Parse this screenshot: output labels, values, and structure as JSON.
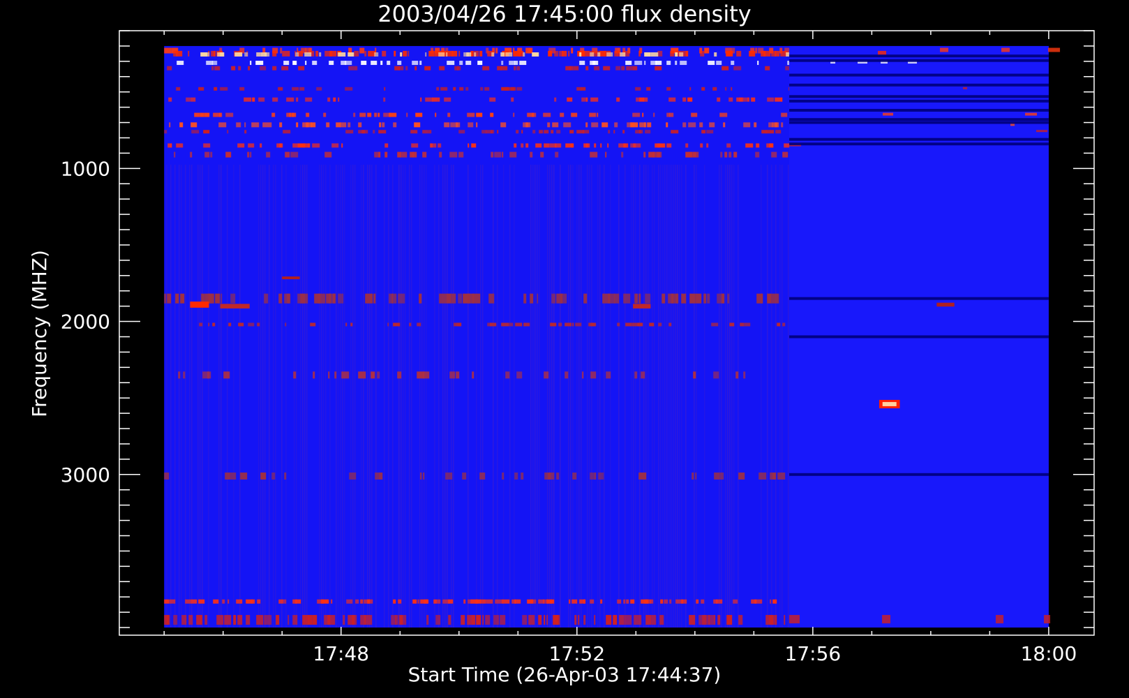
{
  "chart_data": {
    "type": "heatmap",
    "title": "2003/04/26 17:45:00 flux density",
    "xlabel": "Start Time (26-Apr-03 17:44:37)",
    "ylabel": "Frequency (MHZ)",
    "x_ticks": [
      "17:48",
      "17:52",
      "17:56",
      "18:00"
    ],
    "x_tick_minutes": [
      48,
      52,
      56,
      60
    ],
    "x_data_range_minutes": [
      45,
      60
    ],
    "x_axis_range_minutes": [
      44.24,
      60.77
    ],
    "y_ticks": [
      1000,
      2000,
      3000
    ],
    "y_axis_range_mhz": [
      100,
      4050
    ],
    "y_data_range_mhz": [
      200,
      4000
    ],
    "y_reversed": true,
    "colormap": [
      "#00008c",
      "#1e1eff",
      "#ff1e1e",
      "#ffffff"
    ],
    "background_color": "#1414f5",
    "grid": false,
    "bands": [
      {
        "f": 230,
        "h": 8,
        "color": "#ff3a10",
        "density": 0.35
      },
      {
        "f": 250,
        "h": 8,
        "color": "#ff2a00",
        "density": 0.55
      },
      {
        "f": 255,
        "h": 6,
        "color": "#ffd9a0",
        "density": 0.25
      },
      {
        "f": 310,
        "h": 6,
        "color": "#ffffff",
        "density": 0.35
      },
      {
        "f": 345,
        "h": 6,
        "color": "#d02020",
        "density": 0.25
      },
      {
        "f": 480,
        "h": 5,
        "color": "#c82020",
        "density": 0.3
      },
      {
        "f": 550,
        "h": 6,
        "color": "#ff3010",
        "density": 0.3
      },
      {
        "f": 650,
        "h": 6,
        "color": "#ff4010",
        "density": 0.35
      },
      {
        "f": 715,
        "h": 7,
        "color": "#ff5020",
        "density": 0.45
      },
      {
        "f": 760,
        "h": 5,
        "color": "#d02020",
        "density": 0.3
      },
      {
        "f": 850,
        "h": 6,
        "color": "#ff3010",
        "density": 0.4
      },
      {
        "f": 910,
        "h": 8,
        "color": "#c83030",
        "density": 0.35
      },
      {
        "f": 1850,
        "h": 14,
        "color": "#a03040",
        "density": 0.5
      },
      {
        "f": 2020,
        "h": 5,
        "color": "#c02828",
        "density": 0.3
      },
      {
        "f": 2350,
        "h": 10,
        "color": "#b03040",
        "density": 0.25
      },
      {
        "f": 3010,
        "h": 10,
        "color": "#a03040",
        "density": 0.2
      },
      {
        "f": 3830,
        "h": 6,
        "color": "#ff3010",
        "density": 0.45
      },
      {
        "f": 3950,
        "h": 14,
        "color": "#d02020",
        "density": 0.55
      }
    ],
    "dark_lines_after_switch": [
      265,
      295,
      390,
      455,
      530,
      560,
      620,
      680,
      700,
      810,
      840,
      1850,
      2100,
      3000
    ],
    "switch_time_minutes": 55.6,
    "bursts": [
      {
        "t": 45.6,
        "f": 1890,
        "dt": 0.32,
        "df": 40,
        "color": "#ff2a00"
      },
      {
        "t": 46.2,
        "f": 1900,
        "dt": 0.5,
        "df": 30,
        "color": "#c02828"
      },
      {
        "t": 53.1,
        "f": 1900,
        "dt": 0.3,
        "df": 30,
        "color": "#c02828"
      },
      {
        "t": 57.3,
        "f": 2540,
        "dt": 0.35,
        "df": 55,
        "color": "#ff2000"
      },
      {
        "t": 47.15,
        "f": 1715,
        "dt": 0.3,
        "df": 18,
        "color": "#b02020"
      },
      {
        "t": 58.25,
        "f": 1890,
        "dt": 0.3,
        "df": 25,
        "color": "#b02020"
      }
    ]
  }
}
